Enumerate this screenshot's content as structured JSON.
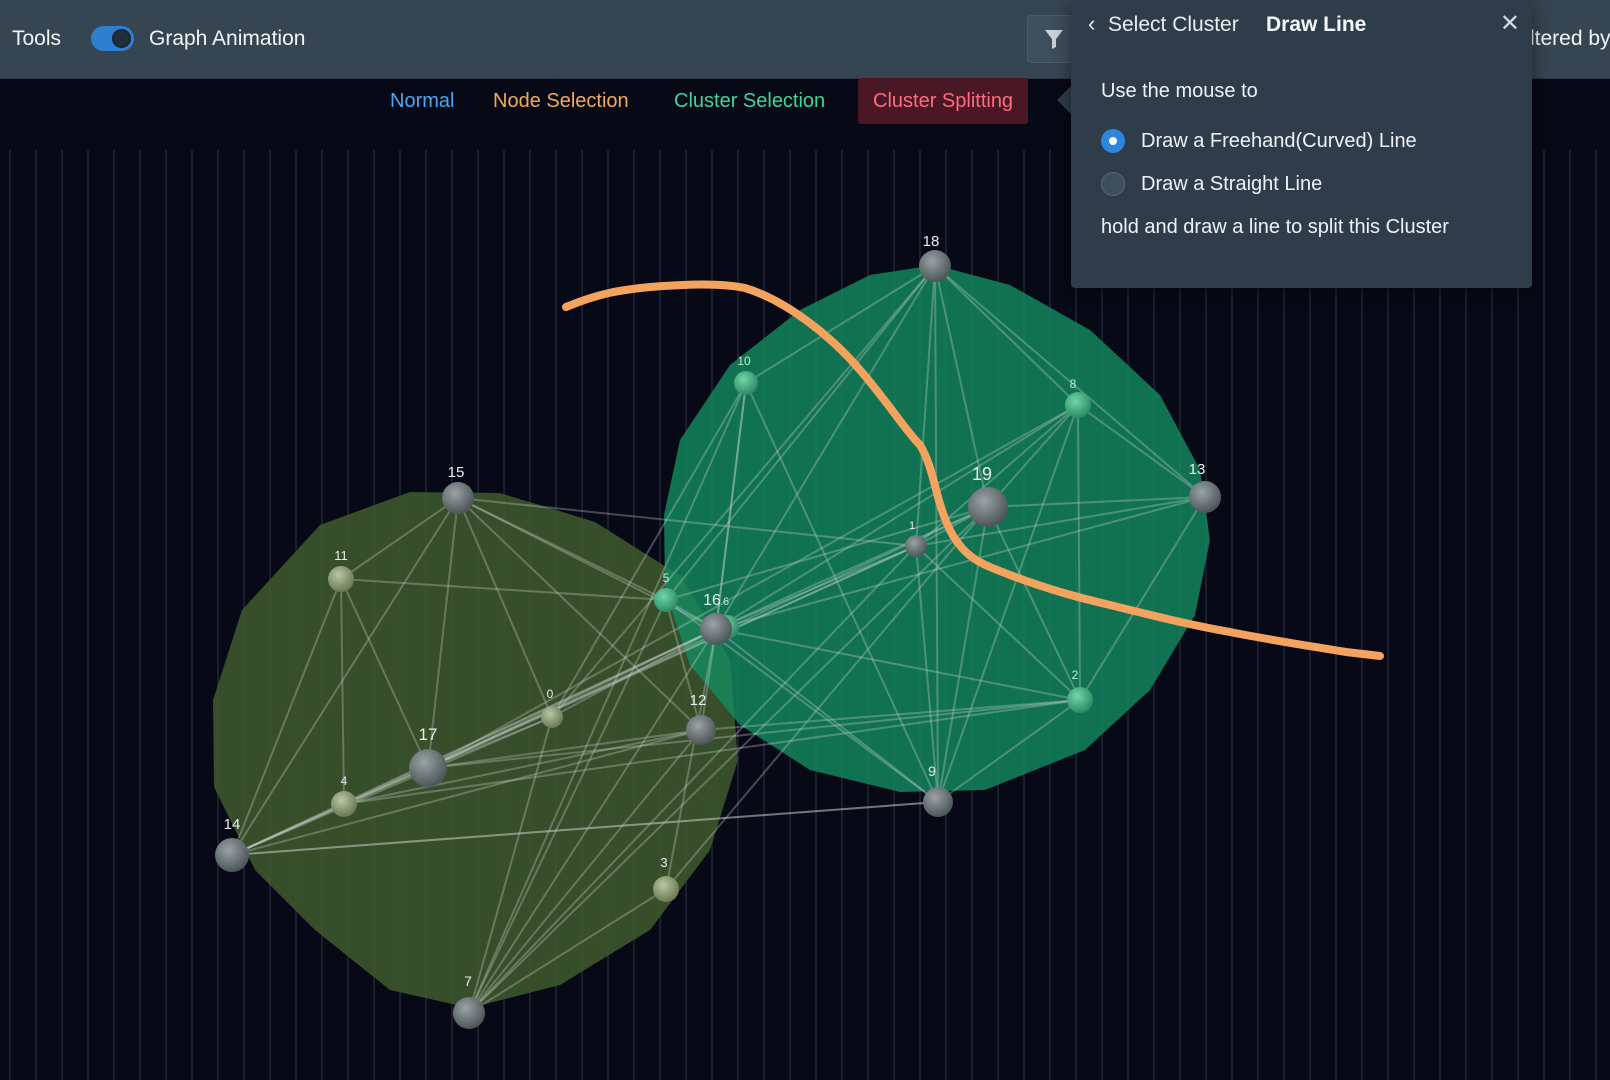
{
  "toolbar": {
    "tools_label": "Tools",
    "graph_animation_label": "Graph Animation",
    "graph_animation_enabled": true,
    "filtered_text": "ltered by"
  },
  "modes": {
    "normal": "Normal",
    "node_selection": "Node Selection",
    "cluster_selection": "Cluster Selection",
    "cluster_splitting": "Cluster Splitting",
    "active": "Cluster Splitting"
  },
  "popover": {
    "breadcrumb": "Select Cluster",
    "title": "Draw Line",
    "intro": "Use the mouse to",
    "options": [
      {
        "label": "Draw a Freehand(Curved) Line",
        "selected": true
      },
      {
        "label": "Draw a Straight Line",
        "selected": false
      }
    ],
    "hint": "hold and draw a line to split this Cluster"
  },
  "graph": {
    "colors": {
      "background": "#080917",
      "grid": "#1b1e2f",
      "cluster_a": "#3f5a2e",
      "cluster_b": "#138a5f",
      "split_line": "#f4a35e",
      "edge": "#c9d3cf"
    },
    "nodes": [
      {
        "id": "0"
      },
      {
        "id": "1"
      },
      {
        "id": "2"
      },
      {
        "id": "3"
      },
      {
        "id": "4"
      },
      {
        "id": "5"
      },
      {
        "id": "6"
      },
      {
        "id": "7"
      },
      {
        "id": "8"
      },
      {
        "id": "9"
      },
      {
        "id": "10"
      },
      {
        "id": "11"
      },
      {
        "id": "12"
      },
      {
        "id": "13"
      },
      {
        "id": "14"
      },
      {
        "id": "15"
      },
      {
        "id": "16"
      },
      {
        "id": "17"
      },
      {
        "id": "18"
      },
      {
        "id": "19"
      }
    ],
    "edges": [
      [
        "15",
        "11"
      ],
      [
        "15",
        "17"
      ],
      [
        "15",
        "14"
      ],
      [
        "15",
        "16"
      ],
      [
        "15",
        "12"
      ],
      [
        "15",
        "5"
      ],
      [
        "15",
        "1"
      ],
      [
        "15",
        "0"
      ],
      [
        "11",
        "4"
      ],
      [
        "11",
        "17"
      ],
      [
        "11",
        "5"
      ],
      [
        "11",
        "14"
      ],
      [
        "14",
        "17"
      ],
      [
        "14",
        "4"
      ],
      [
        "14",
        "16"
      ],
      [
        "14",
        "12"
      ],
      [
        "14",
        "9"
      ],
      [
        "14",
        "0"
      ],
      [
        "14",
        "1"
      ],
      [
        "4",
        "17"
      ],
      [
        "4",
        "16"
      ],
      [
        "4",
        "12"
      ],
      [
        "4",
        "2"
      ],
      [
        "17",
        "16"
      ],
      [
        "17",
        "12"
      ],
      [
        "17",
        "1"
      ],
      [
        "17",
        "19"
      ],
      [
        "17",
        "0"
      ],
      [
        "17",
        "2"
      ],
      [
        "17",
        "8"
      ],
      [
        "0",
        "16"
      ],
      [
        "0",
        "7"
      ],
      [
        "0",
        "10"
      ],
      [
        "0",
        "18"
      ],
      [
        "7",
        "16"
      ],
      [
        "7",
        "12"
      ],
      [
        "7",
        "5"
      ],
      [
        "7",
        "1"
      ],
      [
        "7",
        "19"
      ],
      [
        "7",
        "3"
      ],
      [
        "7",
        "10"
      ],
      [
        "3",
        "16"
      ],
      [
        "3",
        "19"
      ],
      [
        "12",
        "16"
      ],
      [
        "12",
        "2"
      ],
      [
        "12",
        "5"
      ],
      [
        "16",
        "18"
      ],
      [
        "16",
        "10"
      ],
      [
        "16",
        "19"
      ],
      [
        "16",
        "1"
      ],
      [
        "16",
        "8"
      ],
      [
        "16",
        "13"
      ],
      [
        "16",
        "2"
      ],
      [
        "16",
        "9"
      ],
      [
        "16",
        "5"
      ],
      [
        "5",
        "18"
      ],
      [
        "5",
        "19"
      ],
      [
        "5",
        "9"
      ],
      [
        "18",
        "10"
      ],
      [
        "18",
        "19"
      ],
      [
        "18",
        "8"
      ],
      [
        "18",
        "13"
      ],
      [
        "18",
        "1"
      ],
      [
        "18",
        "9"
      ],
      [
        "10",
        "9"
      ],
      [
        "10",
        "16"
      ],
      [
        "19",
        "8"
      ],
      [
        "19",
        "1"
      ],
      [
        "19",
        "2"
      ],
      [
        "19",
        "9"
      ],
      [
        "19",
        "13"
      ],
      [
        "1",
        "9"
      ],
      [
        "1",
        "2"
      ],
      [
        "1",
        "8"
      ],
      [
        "1",
        "13"
      ],
      [
        "8",
        "13"
      ],
      [
        "8",
        "9"
      ],
      [
        "8",
        "2"
      ],
      [
        "13",
        "2"
      ],
      [
        "2",
        "9"
      ],
      [
        "9",
        "14"
      ]
    ]
  }
}
